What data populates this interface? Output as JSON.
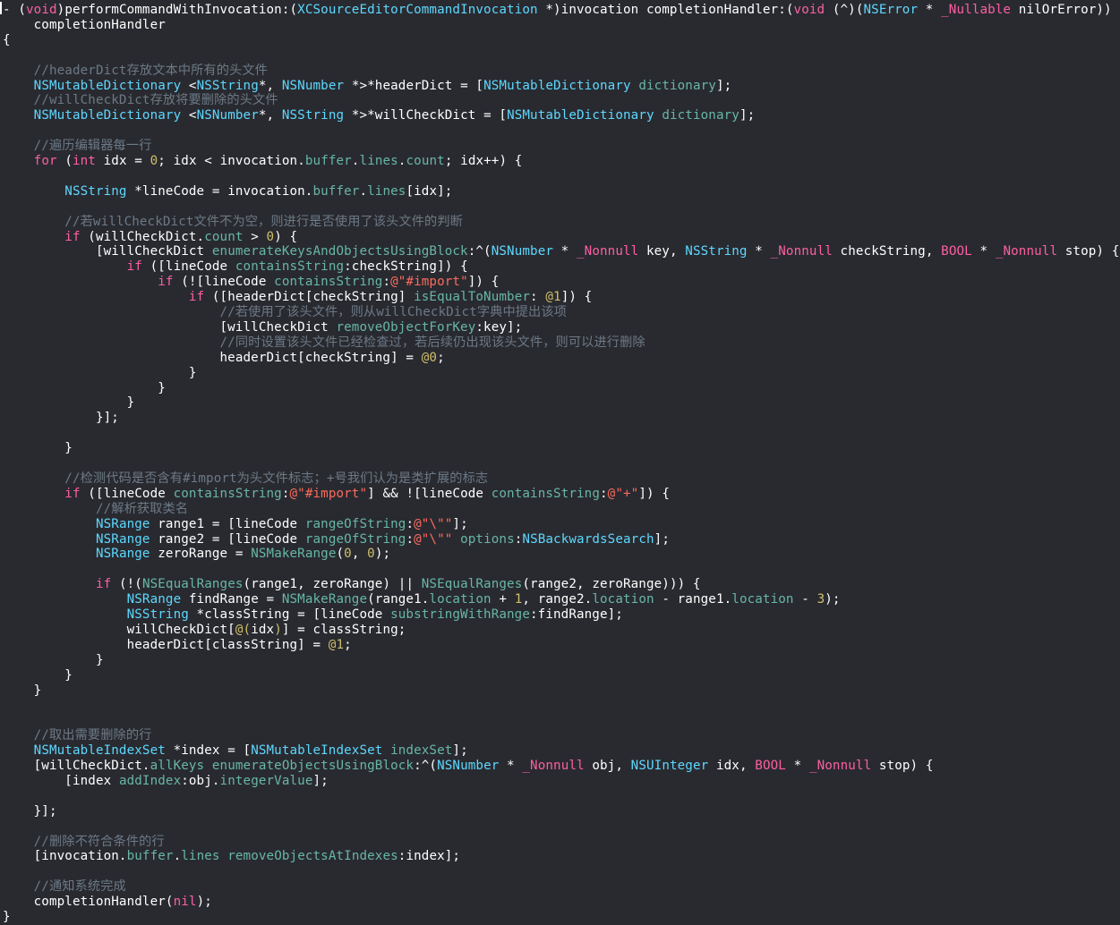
{
  "editor": {
    "language": "Objective-C",
    "theme": {
      "background": "#292a30",
      "plain": "#ffffff",
      "keyword": "#fc5fa3",
      "type": "#5dd8ff",
      "method": "#67b7a4",
      "comment": "#6c7986",
      "number": "#d0bf69",
      "string": "#fc6a5d"
    },
    "lines": [
      {
        "row": 0,
        "tokens": [
          [
            "p",
            "- ("
          ],
          [
            "k",
            "void"
          ],
          [
            "p",
            ")performCommandWithInvocation:("
          ],
          [
            "t",
            "XCSourceEditorCommandInvocation"
          ],
          [
            "p",
            " *)invocation completionHandler:("
          ],
          [
            "k",
            "void"
          ],
          [
            "p",
            " (^)("
          ],
          [
            "t",
            "NSError"
          ],
          [
            "p",
            " * "
          ],
          [
            "k",
            "_Nullable"
          ],
          [
            "p",
            " nilOrError))"
          ]
        ]
      },
      {
        "row": 1,
        "tokens": [
          [
            "p",
            "    completionHandler"
          ]
        ]
      },
      {
        "row": 2,
        "tokens": [
          [
            "p",
            "{"
          ]
        ]
      },
      {
        "row": 4,
        "tokens": [
          [
            "c",
            "    //headerDict存放文本中所有的头文件"
          ]
        ]
      },
      {
        "row": 5,
        "tokens": [
          [
            "p",
            "    "
          ],
          [
            "t",
            "NSMutableDictionary"
          ],
          [
            "p",
            " <"
          ],
          [
            "t",
            "NSString"
          ],
          [
            "p",
            "*, "
          ],
          [
            "t",
            "NSNumber"
          ],
          [
            "p",
            " *>*headerDict = ["
          ],
          [
            "t",
            "NSMutableDictionary"
          ],
          [
            "p",
            " "
          ],
          [
            "m",
            "dictionary"
          ],
          [
            "p",
            "];"
          ]
        ]
      },
      {
        "row": 6,
        "tokens": [
          [
            "c",
            "    //willCheckDict存放将要删除的头文件"
          ]
        ]
      },
      {
        "row": 7,
        "tokens": [
          [
            "p",
            "    "
          ],
          [
            "t",
            "NSMutableDictionary"
          ],
          [
            "p",
            " <"
          ],
          [
            "t",
            "NSNumber"
          ],
          [
            "p",
            "*, "
          ],
          [
            "t",
            "NSString"
          ],
          [
            "p",
            " *>*willCheckDict = ["
          ],
          [
            "t",
            "NSMutableDictionary"
          ],
          [
            "p",
            " "
          ],
          [
            "m",
            "dictionary"
          ],
          [
            "p",
            "];"
          ]
        ]
      },
      {
        "row": 9,
        "tokens": [
          [
            "c",
            "    //遍历编辑器每一行"
          ]
        ]
      },
      {
        "row": 10,
        "tokens": [
          [
            "p",
            "    "
          ],
          [
            "k",
            "for"
          ],
          [
            "p",
            " ("
          ],
          [
            "k",
            "int"
          ],
          [
            "p",
            " idx = "
          ],
          [
            "n",
            "0"
          ],
          [
            "p",
            "; idx < invocation."
          ],
          [
            "m",
            "buffer"
          ],
          [
            "p",
            "."
          ],
          [
            "m",
            "lines"
          ],
          [
            "p",
            "."
          ],
          [
            "m",
            "count"
          ],
          [
            "p",
            "; idx++) {"
          ]
        ]
      },
      {
        "row": 12,
        "tokens": [
          [
            "p",
            "        "
          ],
          [
            "t",
            "NSString"
          ],
          [
            "p",
            " *lineCode = invocation."
          ],
          [
            "m",
            "buffer"
          ],
          [
            "p",
            "."
          ],
          [
            "m",
            "lines"
          ],
          [
            "p",
            "[idx];"
          ]
        ]
      },
      {
        "row": 14,
        "tokens": [
          [
            "c",
            "        //若willCheckDict文件不为空，则进行是否使用了该头文件的判断"
          ]
        ]
      },
      {
        "row": 15,
        "tokens": [
          [
            "p",
            "        "
          ],
          [
            "k",
            "if"
          ],
          [
            "p",
            " (willCheckDict."
          ],
          [
            "m",
            "count"
          ],
          [
            "p",
            " > "
          ],
          [
            "n",
            "0"
          ],
          [
            "p",
            ") {"
          ]
        ]
      },
      {
        "row": 16,
        "tokens": [
          [
            "p",
            "            [willCheckDict "
          ],
          [
            "m",
            "enumerateKeysAndObjectsUsingBlock"
          ],
          [
            "p",
            ":^("
          ],
          [
            "t",
            "NSNumber"
          ],
          [
            "p",
            " * "
          ],
          [
            "k",
            "_Nonnull"
          ],
          [
            "p",
            " key, "
          ],
          [
            "t",
            "NSString"
          ],
          [
            "p",
            " * "
          ],
          [
            "k",
            "_Nonnull"
          ],
          [
            "p",
            " checkString, "
          ],
          [
            "k",
            "BOOL"
          ],
          [
            "p",
            " * "
          ],
          [
            "k",
            "_Nonnull"
          ],
          [
            "p",
            " stop) {"
          ]
        ]
      },
      {
        "row": 17,
        "tokens": [
          [
            "p",
            "                "
          ],
          [
            "k",
            "if"
          ],
          [
            "p",
            " ([lineCode "
          ],
          [
            "m",
            "containsString"
          ],
          [
            "p",
            ":checkString]) {"
          ]
        ]
      },
      {
        "row": 18,
        "tokens": [
          [
            "p",
            "                    "
          ],
          [
            "k",
            "if"
          ],
          [
            "p",
            " (![lineCode "
          ],
          [
            "m",
            "containsString"
          ],
          [
            "p",
            ":"
          ],
          [
            "s",
            "@\"#import\""
          ],
          [
            "p",
            "]) {"
          ]
        ]
      },
      {
        "row": 19,
        "tokens": [
          [
            "p",
            "                        "
          ],
          [
            "k",
            "if"
          ],
          [
            "p",
            " ([headerDict[checkString] "
          ],
          [
            "m",
            "isEqualToNumber"
          ],
          [
            "p",
            ": "
          ],
          [
            "n",
            "@1"
          ],
          [
            "p",
            "]) {"
          ]
        ]
      },
      {
        "row": 20,
        "tokens": [
          [
            "c",
            "                            //若使用了该头文件，则从willCheckDict字典中提出该项"
          ]
        ]
      },
      {
        "row": 21,
        "tokens": [
          [
            "p",
            "                            [willCheckDict "
          ],
          [
            "m",
            "removeObjectForKey"
          ],
          [
            "p",
            ":key];"
          ]
        ]
      },
      {
        "row": 22,
        "tokens": [
          [
            "c",
            "                            //同时设置该头文件已经检查过，若后续仍出现该头文件，则可以进行删除"
          ]
        ]
      },
      {
        "row": 23,
        "tokens": [
          [
            "p",
            "                            headerDict[checkString] = "
          ],
          [
            "n",
            "@0"
          ],
          [
            "p",
            ";"
          ]
        ]
      },
      {
        "row": 24,
        "tokens": [
          [
            "p",
            "                        }"
          ]
        ]
      },
      {
        "row": 25,
        "tokens": [
          [
            "p",
            "                    }"
          ]
        ]
      },
      {
        "row": 26,
        "tokens": [
          [
            "p",
            "                }"
          ]
        ]
      },
      {
        "row": 27,
        "tokens": [
          [
            "p",
            "            }];"
          ]
        ]
      },
      {
        "row": 29,
        "tokens": [
          [
            "p",
            "        }"
          ]
        ]
      },
      {
        "row": 31,
        "tokens": [
          [
            "c",
            "        //检测代码是否含有#import为头文件标志；+号我们认为是类扩展的标志"
          ]
        ]
      },
      {
        "row": 32,
        "tokens": [
          [
            "p",
            "        "
          ],
          [
            "k",
            "if"
          ],
          [
            "p",
            " ([lineCode "
          ],
          [
            "m",
            "containsString"
          ],
          [
            "p",
            ":"
          ],
          [
            "s",
            "@\"#import\""
          ],
          [
            "p",
            "] && ![lineCode "
          ],
          [
            "m",
            "containsString"
          ],
          [
            "p",
            ":"
          ],
          [
            "s",
            "@\"+\""
          ],
          [
            "p",
            "]) {"
          ]
        ]
      },
      {
        "row": 33,
        "tokens": [
          [
            "c",
            "            //解析获取类名"
          ]
        ]
      },
      {
        "row": 34,
        "tokens": [
          [
            "p",
            "            "
          ],
          [
            "t",
            "NSRange"
          ],
          [
            "p",
            " range1 = [lineCode "
          ],
          [
            "m",
            "rangeOfString"
          ],
          [
            "p",
            ":"
          ],
          [
            "s",
            "@\"\\\"\""
          ],
          [
            "p",
            "];"
          ]
        ]
      },
      {
        "row": 35,
        "tokens": [
          [
            "p",
            "            "
          ],
          [
            "t",
            "NSRange"
          ],
          [
            "p",
            " range2 = [lineCode "
          ],
          [
            "m",
            "rangeOfString"
          ],
          [
            "p",
            ":"
          ],
          [
            "s",
            "@\"\\\"\""
          ],
          [
            "p",
            " "
          ],
          [
            "m",
            "options"
          ],
          [
            "p",
            ":"
          ],
          [
            "t",
            "NSBackwardsSearch"
          ],
          [
            "p",
            "];"
          ]
        ]
      },
      {
        "row": 36,
        "tokens": [
          [
            "p",
            "            "
          ],
          [
            "t",
            "NSRange"
          ],
          [
            "p",
            " zeroRange = "
          ],
          [
            "m",
            "NSMakeRange"
          ],
          [
            "p",
            "("
          ],
          [
            "n",
            "0"
          ],
          [
            "p",
            ", "
          ],
          [
            "n",
            "0"
          ],
          [
            "p",
            ");"
          ]
        ]
      },
      {
        "row": 38,
        "tokens": [
          [
            "p",
            "            "
          ],
          [
            "k",
            "if"
          ],
          [
            "p",
            " (!("
          ],
          [
            "m",
            "NSEqualRanges"
          ],
          [
            "p",
            "(range1, zeroRange) || "
          ],
          [
            "m",
            "NSEqualRanges"
          ],
          [
            "p",
            "(range2, zeroRange))) {"
          ]
        ]
      },
      {
        "row": 39,
        "tokens": [
          [
            "p",
            "                "
          ],
          [
            "t",
            "NSRange"
          ],
          [
            "p",
            " findRange = "
          ],
          [
            "m",
            "NSMakeRange"
          ],
          [
            "p",
            "(range1."
          ],
          [
            "m",
            "location"
          ],
          [
            "p",
            " + "
          ],
          [
            "n",
            "1"
          ],
          [
            "p",
            ", range2."
          ],
          [
            "m",
            "location"
          ],
          [
            "p",
            " - range1."
          ],
          [
            "m",
            "location"
          ],
          [
            "p",
            " - "
          ],
          [
            "n",
            "3"
          ],
          [
            "p",
            ");"
          ]
        ]
      },
      {
        "row": 40,
        "tokens": [
          [
            "p",
            "                "
          ],
          [
            "t",
            "NSString"
          ],
          [
            "p",
            " *classString = [lineCode "
          ],
          [
            "m",
            "substringWithRange"
          ],
          [
            "p",
            ":findRange];"
          ]
        ]
      },
      {
        "row": 41,
        "tokens": [
          [
            "p",
            "                willCheckDict["
          ],
          [
            "n",
            "@("
          ],
          [
            "p",
            "idx"
          ],
          [
            "n",
            ")"
          ],
          [
            "p",
            "] = classString;"
          ]
        ]
      },
      {
        "row": 42,
        "tokens": [
          [
            "p",
            "                headerDict[classString] = "
          ],
          [
            "n",
            "@1"
          ],
          [
            "p",
            ";"
          ]
        ]
      },
      {
        "row": 43,
        "tokens": [
          [
            "p",
            "            }"
          ]
        ]
      },
      {
        "row": 44,
        "tokens": [
          [
            "p",
            "        }"
          ]
        ]
      },
      {
        "row": 45,
        "tokens": [
          [
            "p",
            "    }"
          ]
        ]
      },
      {
        "row": 48,
        "tokens": [
          [
            "c",
            "    //取出需要删除的行"
          ]
        ]
      },
      {
        "row": 49,
        "tokens": [
          [
            "p",
            "    "
          ],
          [
            "t",
            "NSMutableIndexSet"
          ],
          [
            "p",
            " *index = ["
          ],
          [
            "t",
            "NSMutableIndexSet"
          ],
          [
            "p",
            " "
          ],
          [
            "m",
            "indexSet"
          ],
          [
            "p",
            "];"
          ]
        ]
      },
      {
        "row": 50,
        "tokens": [
          [
            "p",
            "    [willCheckDict."
          ],
          [
            "m",
            "allKeys"
          ],
          [
            "p",
            " "
          ],
          [
            "m",
            "enumerateObjectsUsingBlock"
          ],
          [
            "p",
            ":^("
          ],
          [
            "t",
            "NSNumber"
          ],
          [
            "p",
            " * "
          ],
          [
            "k",
            "_Nonnull"
          ],
          [
            "p",
            " obj, "
          ],
          [
            "t",
            "NSUInteger"
          ],
          [
            "p",
            " idx, "
          ],
          [
            "k",
            "BOOL"
          ],
          [
            "p",
            " * "
          ],
          [
            "k",
            "_Nonnull"
          ],
          [
            "p",
            " stop) {"
          ]
        ]
      },
      {
        "row": 51,
        "tokens": [
          [
            "p",
            "        [index "
          ],
          [
            "m",
            "addIndex"
          ],
          [
            "p",
            ":obj."
          ],
          [
            "m",
            "integerValue"
          ],
          [
            "p",
            "];"
          ]
        ]
      },
      {
        "row": 53,
        "tokens": [
          [
            "p",
            "    }];"
          ]
        ]
      },
      {
        "row": 55,
        "tokens": [
          [
            "c",
            "    //删除不符合条件的行"
          ]
        ]
      },
      {
        "row": 56,
        "tokens": [
          [
            "p",
            "    [invocation."
          ],
          [
            "m",
            "buffer"
          ],
          [
            "p",
            "."
          ],
          [
            "m",
            "lines"
          ],
          [
            "p",
            " "
          ],
          [
            "m",
            "removeObjectsAtIndexes"
          ],
          [
            "p",
            ":index];"
          ]
        ]
      },
      {
        "row": 58,
        "tokens": [
          [
            "c",
            "    //通知系统完成"
          ]
        ]
      },
      {
        "row": 59,
        "tokens": [
          [
            "p",
            "    completionHandler("
          ],
          [
            "k",
            "nil"
          ],
          [
            "p",
            ");"
          ]
        ]
      },
      {
        "row": 60,
        "tokens": [
          [
            "p",
            "}"
          ]
        ]
      }
    ]
  }
}
